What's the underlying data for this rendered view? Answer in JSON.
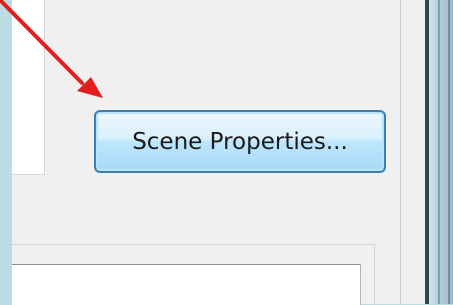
{
  "scene_properties_button": {
    "label": "Scene Properties..."
  },
  "annotation": {
    "color": "#e41e1e",
    "icon": "arrow-pointer-icon"
  },
  "colors": {
    "background": "#b9dde2",
    "dialog": "#f0f0f0",
    "button_border": "#3c7fb1",
    "divider": "#2f4753"
  }
}
